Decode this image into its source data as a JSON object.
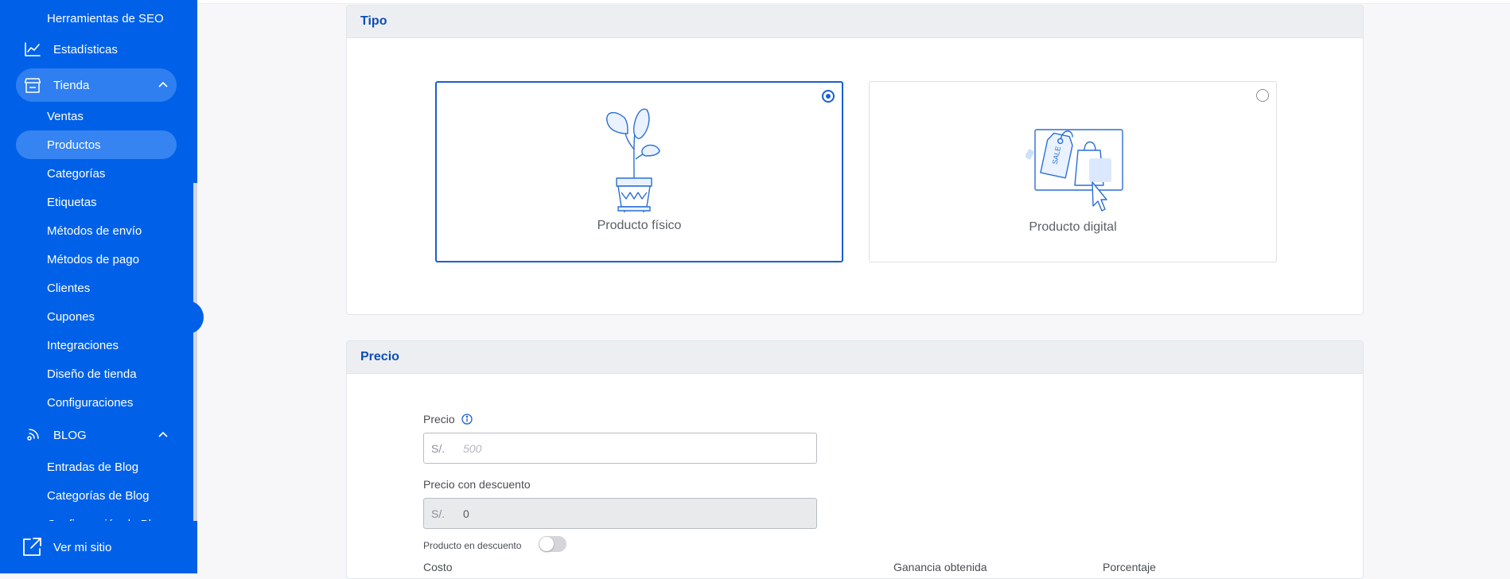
{
  "sidebar": {
    "seo_tools": "Herramientas de SEO",
    "stats": "Estadísticas",
    "store": "Tienda",
    "store_items": [
      "Ventas",
      "Productos",
      "Categorías",
      "Etiquetas",
      "Métodos de envío",
      "Métodos de pago",
      "Clientes",
      "Cupones",
      "Integraciones",
      "Diseño de tienda",
      "Configuraciones"
    ],
    "active_store_item": "Productos",
    "blog": "BLOG",
    "blog_items": [
      "Entradas de Blog",
      "Categorías de Blog",
      "Configuración de Blog"
    ],
    "footer_link": "Ver mi sitio"
  },
  "tipo": {
    "title": "Tipo",
    "options": [
      {
        "label": "Producto físico",
        "selected": true,
        "icon": "plant-pot-icon"
      },
      {
        "label": "Producto digital",
        "selected": false,
        "icon": "digital-tags-bag-icon"
      }
    ]
  },
  "precio": {
    "title": "Precio",
    "price_label": "Precio",
    "price_prefix": "S/.",
    "price_placeholder": "500",
    "discount_label": "Precio con descuento",
    "discount_prefix": "S/.",
    "discount_value": "0",
    "on_discount_label": "Producto en descuento",
    "on_discount": false,
    "cost_label": "Costo",
    "profit_label": "Ganancia obtenida",
    "percent_label": "Porcentaje"
  },
  "colors": {
    "sidebar": "#0061e8",
    "accent": "#1a5fd0",
    "header_text": "#0b4fb3"
  }
}
